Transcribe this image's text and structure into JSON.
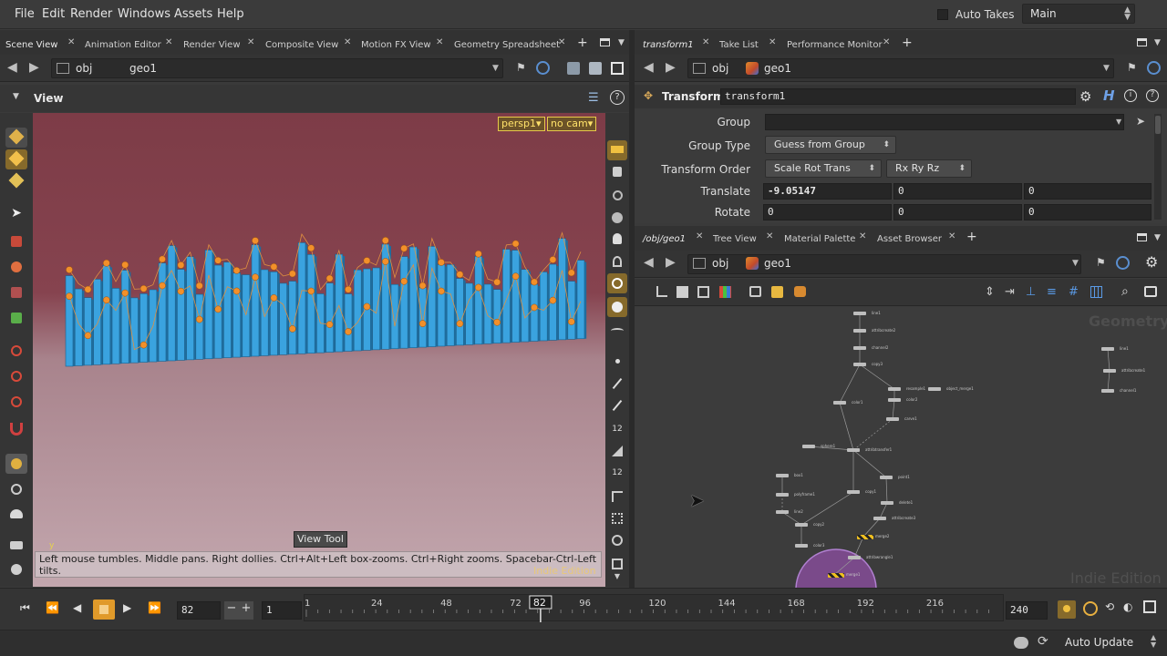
{
  "menu": {
    "items": [
      "File",
      "Edit",
      "Render",
      "Windows",
      "Assets",
      "Help"
    ],
    "auto_takes_label": "Auto Takes",
    "desktop_value": "Main"
  },
  "left_pane": {
    "tabs": [
      "Scene View",
      "Animation Editor",
      "Render View",
      "Composite View",
      "Motion FX View",
      "Geometry Spreadsheet"
    ],
    "path": [
      "obj",
      "geo1"
    ],
    "view_title": "View",
    "camera_menu": "persp1▾",
    "cam_menu": "no cam▾",
    "tool_tooltip": "View Tool",
    "help_text": "Left mouse tumbles. Middle pans. Right dollies. Ctrl+Alt+Left box-zooms. Ctrl+Right zooms. Spacebar-Ctrl-Left tilts.",
    "watermark": "Indie Edition",
    "axis_label": "y"
  },
  "parm_pane": {
    "tabs": [
      "transform1",
      "Take List",
      "Performance Monitor"
    ],
    "path": [
      "obj",
      "geo1"
    ],
    "node_type": "Transform",
    "node_name": "transform1",
    "group_label": "Group",
    "group_value": "",
    "group_type_label": "Group Type",
    "group_type_value": "Guess from Group",
    "transform_order_label": "Transform Order",
    "transform_order_value": "Scale Rot Trans",
    "rot_order_value": "Rx Ry Rz",
    "translate_label": "Translate",
    "translate": [
      "-9.05147",
      "0",
      "0"
    ],
    "rotate_label": "Rotate",
    "rotate": [
      "0",
      "0",
      "0"
    ]
  },
  "network_pane": {
    "tabs": [
      "/obj/geo1",
      "Tree View",
      "Material Palette",
      "Asset Browser"
    ],
    "path": [
      "obj",
      "geo1"
    ],
    "context_label": "Geometry",
    "watermark": "Indie Edition",
    "nodes": [
      {
        "label": "line1"
      },
      {
        "label": "attribcreate2"
      },
      {
        "label": "channel2"
      },
      {
        "label": "copy3"
      },
      {
        "label": "resample1"
      },
      {
        "label": "object_merge1"
      },
      {
        "label": "color1"
      },
      {
        "label": "color2"
      },
      {
        "label": "carve1"
      },
      {
        "label": "sphere1"
      },
      {
        "label": "attribtransfer1"
      },
      {
        "label": "point1"
      },
      {
        "label": "box1"
      },
      {
        "label": "polyframe1"
      },
      {
        "label": "copy1"
      },
      {
        "label": "delete1"
      },
      {
        "label": "line2"
      },
      {
        "label": "copy2"
      },
      {
        "label": "attribcreate3"
      },
      {
        "label": "merge2"
      },
      {
        "label": "color3"
      },
      {
        "label": "attribwrangle1"
      },
      {
        "label": "merge1"
      },
      {
        "label": "line1"
      },
      {
        "label": "attribcreate1"
      },
      {
        "label": "channel1"
      }
    ]
  },
  "timeline": {
    "current_frame": "82",
    "start_frame": "1",
    "end_frame": "240",
    "ticks": [
      "1",
      "24",
      "48",
      "72",
      "96",
      "120",
      "144",
      "168",
      "192",
      "216"
    ],
    "marker": "82"
  },
  "status": {
    "update_mode": "Auto Update"
  },
  "colors": {
    "viewport_top": "#7b3a44",
    "viewport_bottom": "#c9a9b1",
    "bar_color": "#3aa3df",
    "point_color": "#f2902a",
    "accent": "#e8a531"
  }
}
